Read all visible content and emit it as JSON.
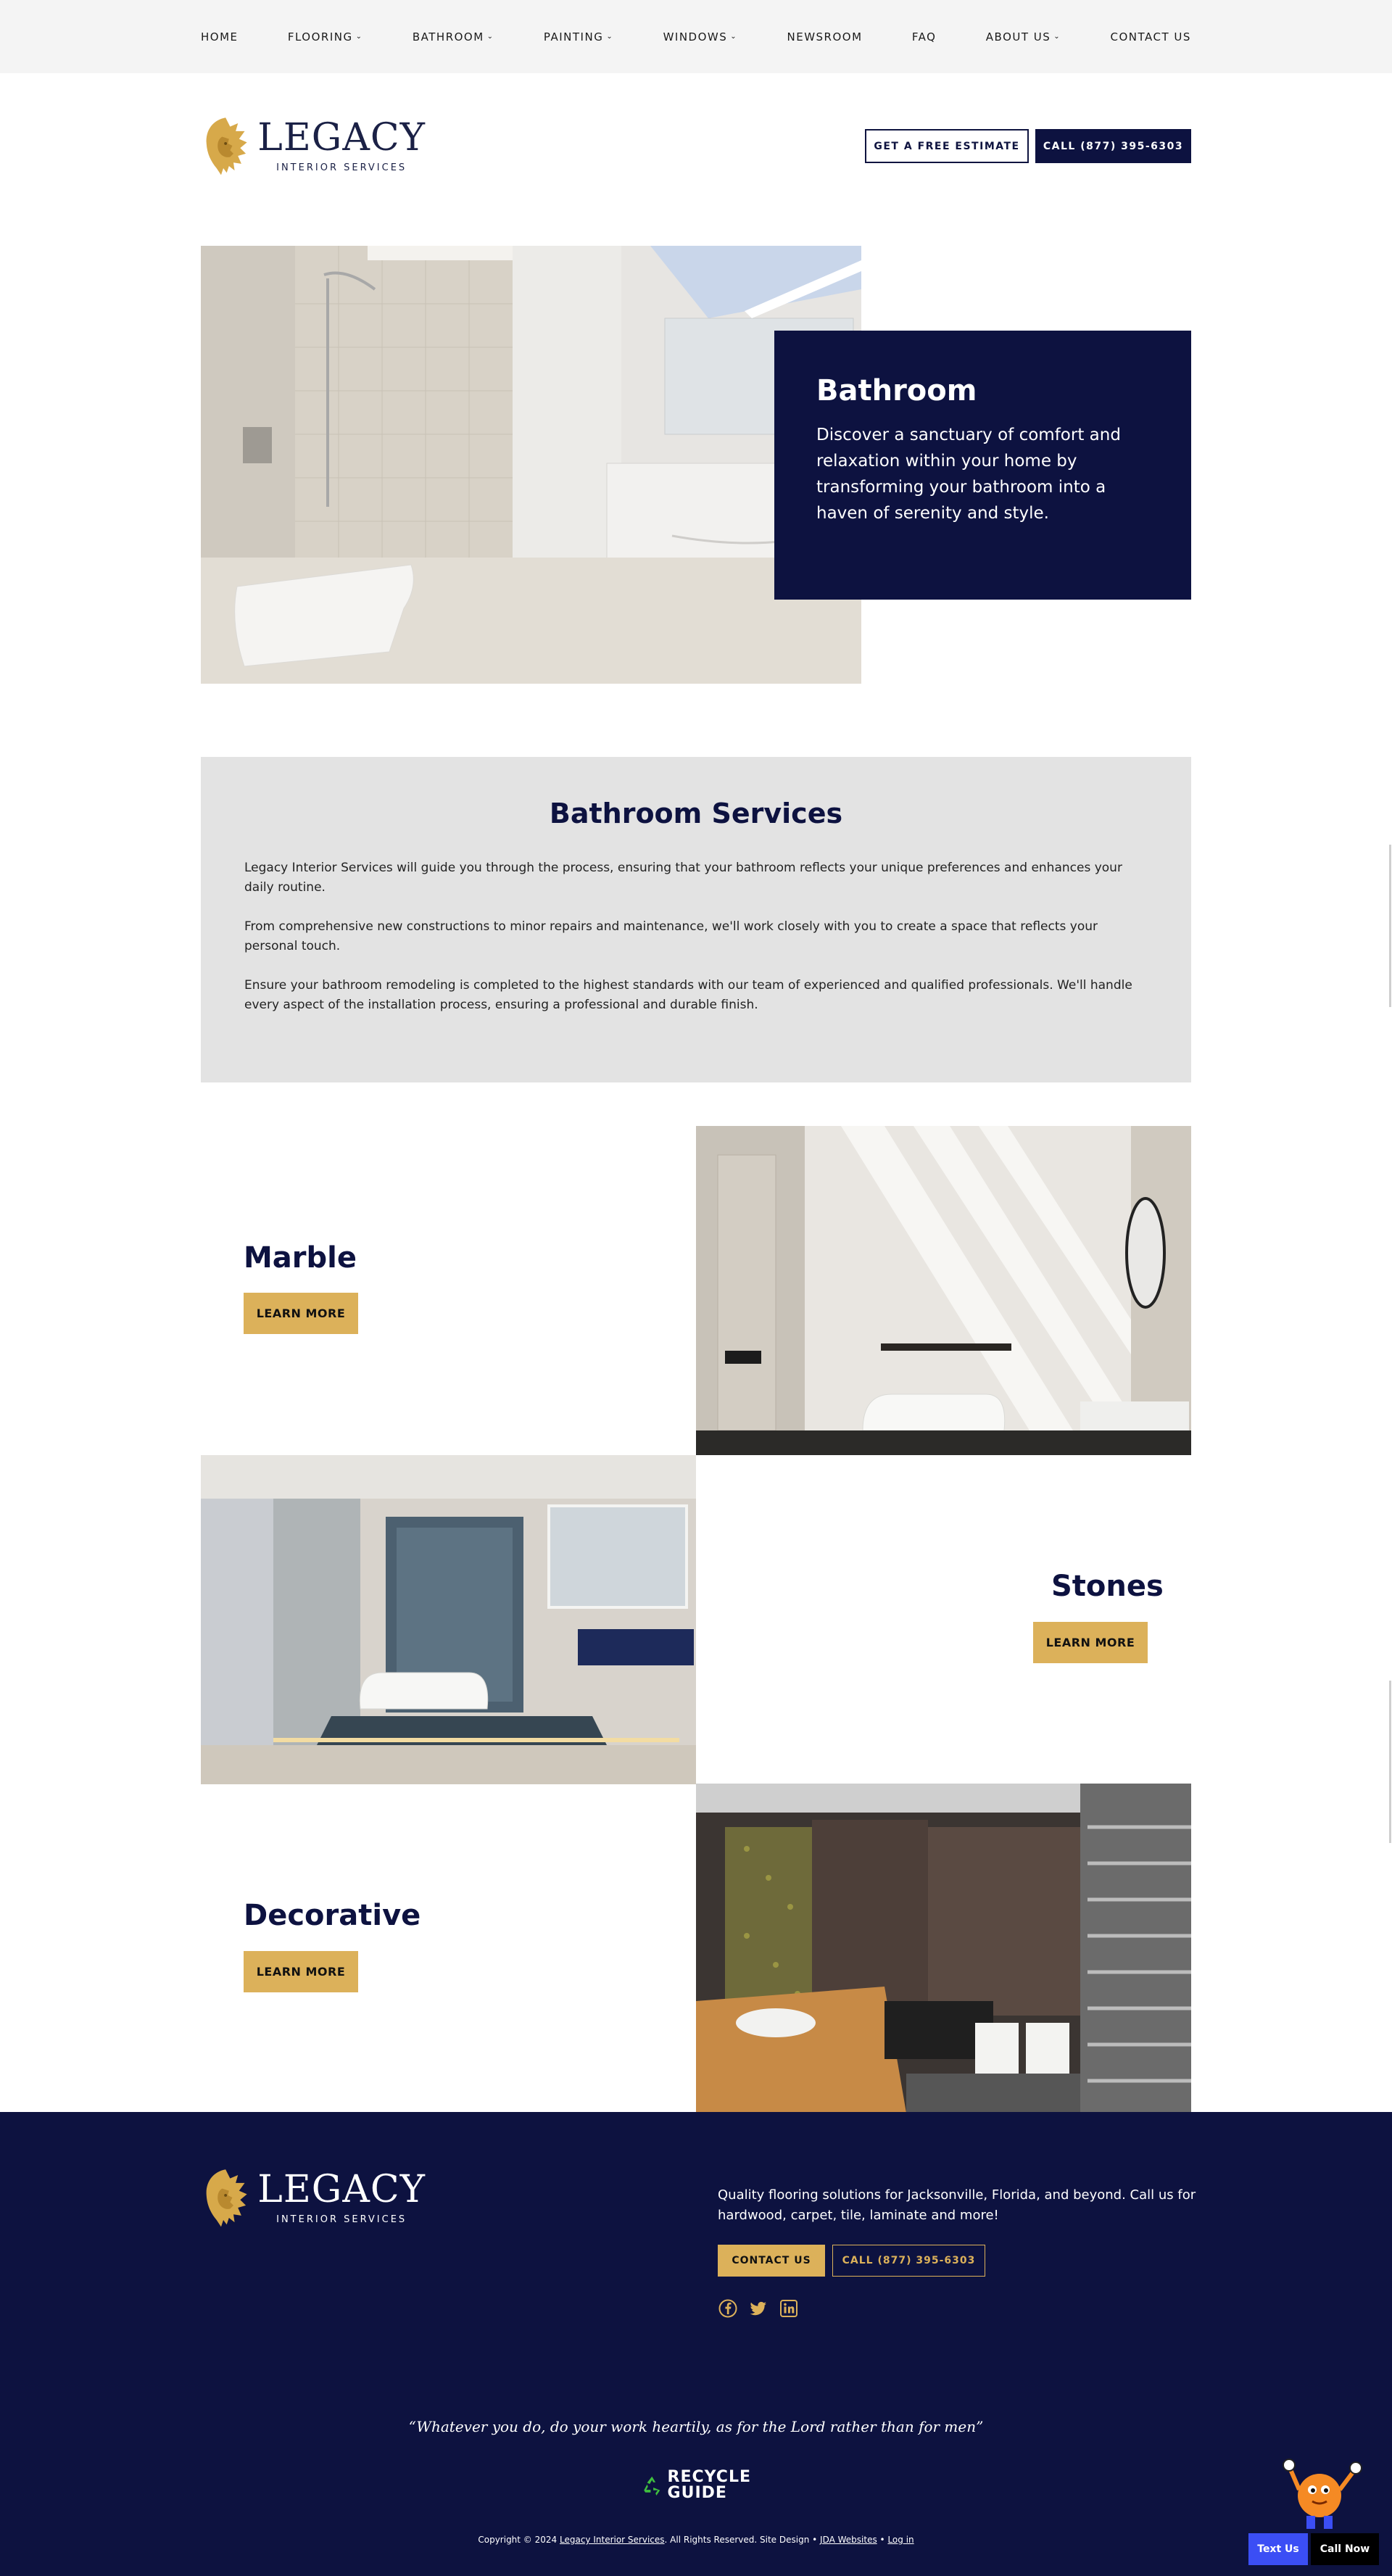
{
  "nav": {
    "items": [
      {
        "label": "HOME",
        "dropdown": false
      },
      {
        "label": "FLOORING",
        "dropdown": true
      },
      {
        "label": "BATHROOM",
        "dropdown": true
      },
      {
        "label": "PAINTING",
        "dropdown": true
      },
      {
        "label": "WINDOWS",
        "dropdown": true
      },
      {
        "label": "NEWSROOM",
        "dropdown": false
      },
      {
        "label": "FAQ",
        "dropdown": false
      },
      {
        "label": "ABOUT US",
        "dropdown": true
      },
      {
        "label": "CONTACT US",
        "dropdown": false
      }
    ]
  },
  "header": {
    "logo_main": "LEGACY",
    "logo_sub": "INTERIOR SERVICES",
    "estimate_button": "GET A FREE ESTIMATE",
    "call_button": "CALL (877) 395-6303"
  },
  "hero": {
    "title": "Bathroom",
    "text": "Discover a sanctuary of comfort and relaxation within your home by transforming your bathroom into a haven of serenity and style."
  },
  "services": {
    "title": "Bathroom Services",
    "paragraphs": [
      "Legacy Interior Services will guide you through the process, ensuring that your bathroom reflects your unique preferences and enhances your daily routine.",
      "From comprehensive new constructions to minor repairs and maintenance, we'll work closely with you to create a space that reflects your personal touch.",
      "Ensure your bathroom remodeling is completed to the highest standards with our team of experienced and qualified professionals. We'll handle every aspect of the installation process, ensuring a professional and durable finish."
    ]
  },
  "features": [
    {
      "title": "Marble",
      "button": "LEARN MORE"
    },
    {
      "title": "Stones",
      "button": "LEARN MORE"
    },
    {
      "title": "Decorative",
      "button": "LEARN MORE"
    }
  ],
  "footer": {
    "logo_main": "LEGACY",
    "logo_sub": "INTERIOR SERVICES",
    "blurb": "Quality flooring solutions for Jacksonville, Florida, and beyond. Call us for hardwood, carpet, tile, laminate and more!",
    "contact_button": "CONTACT US",
    "call_button": "CALL (877) 395-6303",
    "social": [
      "facebook-icon",
      "twitter-icon",
      "linkedin-icon"
    ],
    "quote": "“Whatever you do, do your work heartily, as for the Lord rather than for men”",
    "recycle_line1": "RECYCLE",
    "recycle_line2": "GUIDE",
    "copyright_prefix": "Copyright © 2024",
    "copyright_link": "Legacy Interior Services",
    "copyright_mid": ". All Rights Reserved. Site Design •",
    "design_link": "JDA Websites",
    "sep": "•",
    "login_link": "Log in"
  },
  "floating": {
    "text_us": "Text Us",
    "call_now": "Call Now"
  },
  "colors": {
    "navy": "#0d1240",
    "gold": "#dcb15a",
    "services_bg": "#e3e3e3",
    "nav_bg": "#f4f4f4"
  }
}
